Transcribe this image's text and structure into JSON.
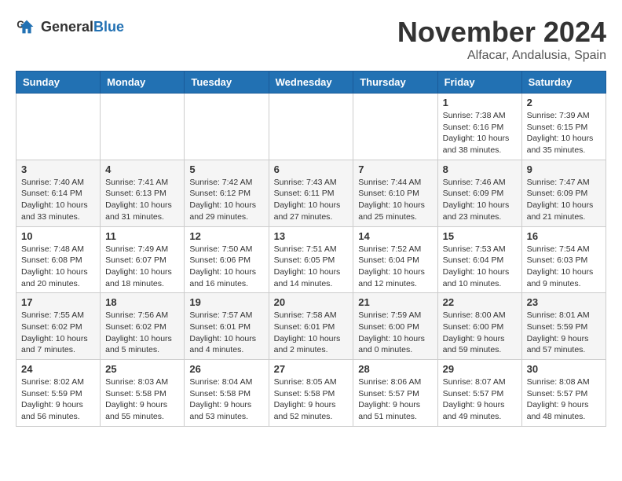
{
  "header": {
    "logo_general": "General",
    "logo_blue": "Blue",
    "month_title": "November 2024",
    "location": "Alfacar, Andalusia, Spain"
  },
  "weekdays": [
    "Sunday",
    "Monday",
    "Tuesday",
    "Wednesday",
    "Thursday",
    "Friday",
    "Saturday"
  ],
  "weeks": [
    [
      {
        "day": "",
        "info": ""
      },
      {
        "day": "",
        "info": ""
      },
      {
        "day": "",
        "info": ""
      },
      {
        "day": "",
        "info": ""
      },
      {
        "day": "",
        "info": ""
      },
      {
        "day": "1",
        "info": "Sunrise: 7:38 AM\nSunset: 6:16 PM\nDaylight: 10 hours and 38 minutes."
      },
      {
        "day": "2",
        "info": "Sunrise: 7:39 AM\nSunset: 6:15 PM\nDaylight: 10 hours and 35 minutes."
      }
    ],
    [
      {
        "day": "3",
        "info": "Sunrise: 7:40 AM\nSunset: 6:14 PM\nDaylight: 10 hours and 33 minutes."
      },
      {
        "day": "4",
        "info": "Sunrise: 7:41 AM\nSunset: 6:13 PM\nDaylight: 10 hours and 31 minutes."
      },
      {
        "day": "5",
        "info": "Sunrise: 7:42 AM\nSunset: 6:12 PM\nDaylight: 10 hours and 29 minutes."
      },
      {
        "day": "6",
        "info": "Sunrise: 7:43 AM\nSunset: 6:11 PM\nDaylight: 10 hours and 27 minutes."
      },
      {
        "day": "7",
        "info": "Sunrise: 7:44 AM\nSunset: 6:10 PM\nDaylight: 10 hours and 25 minutes."
      },
      {
        "day": "8",
        "info": "Sunrise: 7:46 AM\nSunset: 6:09 PM\nDaylight: 10 hours and 23 minutes."
      },
      {
        "day": "9",
        "info": "Sunrise: 7:47 AM\nSunset: 6:09 PM\nDaylight: 10 hours and 21 minutes."
      }
    ],
    [
      {
        "day": "10",
        "info": "Sunrise: 7:48 AM\nSunset: 6:08 PM\nDaylight: 10 hours and 20 minutes."
      },
      {
        "day": "11",
        "info": "Sunrise: 7:49 AM\nSunset: 6:07 PM\nDaylight: 10 hours and 18 minutes."
      },
      {
        "day": "12",
        "info": "Sunrise: 7:50 AM\nSunset: 6:06 PM\nDaylight: 10 hours and 16 minutes."
      },
      {
        "day": "13",
        "info": "Sunrise: 7:51 AM\nSunset: 6:05 PM\nDaylight: 10 hours and 14 minutes."
      },
      {
        "day": "14",
        "info": "Sunrise: 7:52 AM\nSunset: 6:04 PM\nDaylight: 10 hours and 12 minutes."
      },
      {
        "day": "15",
        "info": "Sunrise: 7:53 AM\nSunset: 6:04 PM\nDaylight: 10 hours and 10 minutes."
      },
      {
        "day": "16",
        "info": "Sunrise: 7:54 AM\nSunset: 6:03 PM\nDaylight: 10 hours and 9 minutes."
      }
    ],
    [
      {
        "day": "17",
        "info": "Sunrise: 7:55 AM\nSunset: 6:02 PM\nDaylight: 10 hours and 7 minutes."
      },
      {
        "day": "18",
        "info": "Sunrise: 7:56 AM\nSunset: 6:02 PM\nDaylight: 10 hours and 5 minutes."
      },
      {
        "day": "19",
        "info": "Sunrise: 7:57 AM\nSunset: 6:01 PM\nDaylight: 10 hours and 4 minutes."
      },
      {
        "day": "20",
        "info": "Sunrise: 7:58 AM\nSunset: 6:01 PM\nDaylight: 10 hours and 2 minutes."
      },
      {
        "day": "21",
        "info": "Sunrise: 7:59 AM\nSunset: 6:00 PM\nDaylight: 10 hours and 0 minutes."
      },
      {
        "day": "22",
        "info": "Sunrise: 8:00 AM\nSunset: 6:00 PM\nDaylight: 9 hours and 59 minutes."
      },
      {
        "day": "23",
        "info": "Sunrise: 8:01 AM\nSunset: 5:59 PM\nDaylight: 9 hours and 57 minutes."
      }
    ],
    [
      {
        "day": "24",
        "info": "Sunrise: 8:02 AM\nSunset: 5:59 PM\nDaylight: 9 hours and 56 minutes."
      },
      {
        "day": "25",
        "info": "Sunrise: 8:03 AM\nSunset: 5:58 PM\nDaylight: 9 hours and 55 minutes."
      },
      {
        "day": "26",
        "info": "Sunrise: 8:04 AM\nSunset: 5:58 PM\nDaylight: 9 hours and 53 minutes."
      },
      {
        "day": "27",
        "info": "Sunrise: 8:05 AM\nSunset: 5:58 PM\nDaylight: 9 hours and 52 minutes."
      },
      {
        "day": "28",
        "info": "Sunrise: 8:06 AM\nSunset: 5:57 PM\nDaylight: 9 hours and 51 minutes."
      },
      {
        "day": "29",
        "info": "Sunrise: 8:07 AM\nSunset: 5:57 PM\nDaylight: 9 hours and 49 minutes."
      },
      {
        "day": "30",
        "info": "Sunrise: 8:08 AM\nSunset: 5:57 PM\nDaylight: 9 hours and 48 minutes."
      }
    ]
  ]
}
